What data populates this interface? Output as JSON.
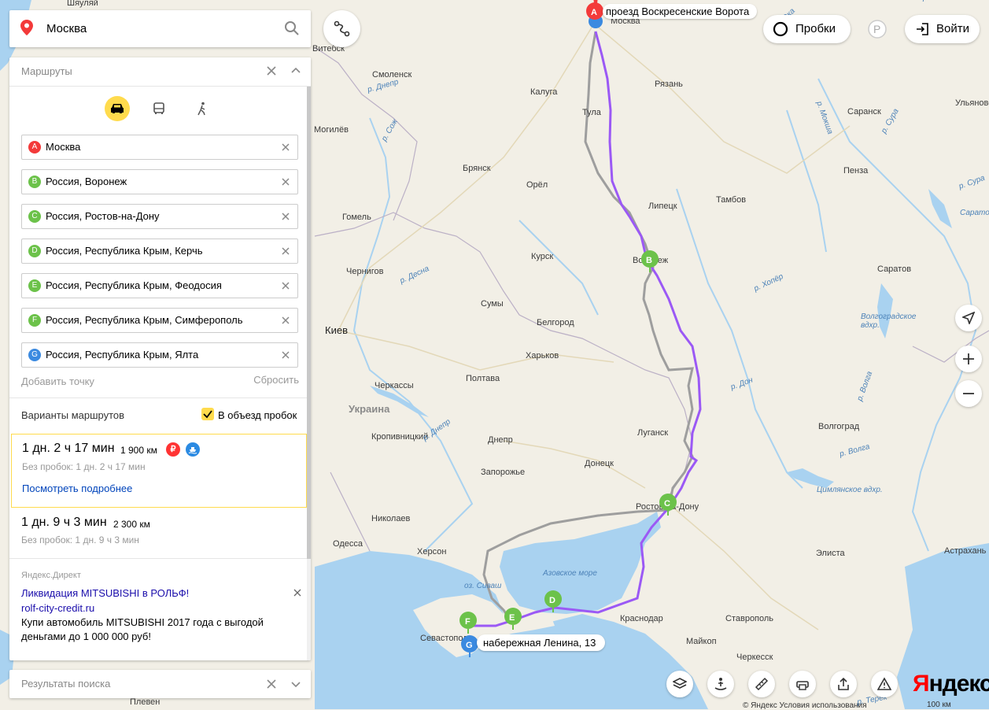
{
  "search": {
    "value": "Москва"
  },
  "panel": {
    "title": "Маршруты",
    "waypoints": [
      {
        "letter": "A",
        "text": "Москва",
        "color": "#f33a3a"
      },
      {
        "letter": "B",
        "text": "Россия, Воронеж",
        "color": "#6cc24a"
      },
      {
        "letter": "C",
        "text": "Россия, Ростов-на-Дону",
        "color": "#6cc24a"
      },
      {
        "letter": "D",
        "text": "Россия, Республика Крым, Керчь",
        "color": "#6cc24a"
      },
      {
        "letter": "E",
        "text": "Россия, Республика Крым, Феодосия",
        "color": "#6cc24a"
      },
      {
        "letter": "F",
        "text": "Россия, Республика Крым, Симферополь",
        "color": "#6cc24a"
      },
      {
        "letter": "G",
        "text": "Россия, Республика Крым, Ялта",
        "color": "#3b8ae0"
      }
    ],
    "add_point": "Добавить точку",
    "reset": "Сбросить",
    "variants_title": "Варианты маршрутов",
    "avoid_traffic": "В объезд пробок",
    "avoid_traffic_checked": true,
    "routes": [
      {
        "time": "1 дн. 2 ч 17 мин",
        "distance": "1 900 км",
        "sub": "Без пробок: 1 дн. 2 ч 17 мин",
        "details": "Посмотреть подробнее",
        "toll": "₽"
      },
      {
        "time": "1 дн. 9 ч 3 мин",
        "distance": "2 300 км",
        "sub": "Без пробок: 1 дн. 9 ч 3 мин"
      }
    ],
    "ad": {
      "label": "Яндекс.Директ",
      "title": "Ликвидация MITSUBISHI в РОЛЬФ!",
      "url": "rolf-city-credit.ru",
      "text": "Купи автомобиль MITSUBISHI 2017 года с выгодой деньгами до 1 000 000 руб!"
    }
  },
  "results": {
    "title": "Результаты поиска"
  },
  "controls": {
    "traffic": "Пробки",
    "parking": "P",
    "login": "Войти"
  },
  "map": {
    "start_label": "проезд Воскресенские Ворота",
    "start_letter": "A",
    "start_city_partial": "М",
    "end_label": "набережная Ленина, 13",
    "pins": [
      "B",
      "C",
      "D",
      "E",
      "F",
      "G"
    ],
    "route_color": "#9b59f5",
    "alt_route_color": "#a0a0a0",
    "cities": [
      "Москва",
      "Витебск",
      "Смоленск",
      "Калуга",
      "Рязань",
      "Тула",
      "Саранск",
      "Ульяновск",
      "Могилёв",
      "Брянск",
      "Орёл",
      "Липецк",
      "Тамбов",
      "Пенза",
      "Гомель",
      "Курск",
      "Воронеж",
      "Чернигов",
      "Саратов",
      "Киев",
      "Сумы",
      "Белгород",
      "Харьков",
      "Черкассы",
      "Полтава",
      "Луганск",
      "Волгоград",
      "Кропивницкий",
      "Днепр",
      "Донецк",
      "Запорожье",
      "Ростов-на-Дону",
      "Николаев",
      "Одесса",
      "Херсон",
      "Элиста",
      "Астрахань",
      "Севастополь",
      "Краснодар",
      "Ставрополь",
      "Майкоп",
      "Черкесск",
      "Плевен",
      "Шяуляй"
    ],
    "rivers": [
      "р. Днепр",
      "р. Сож",
      "р. Десна",
      "р. Днепр",
      "р. Ока",
      "р. Мокша",
      "р. Сура",
      "р. Сура",
      "р. Хопёр",
      "р. Дон",
      "р. Волга",
      "р. Дон",
      "р. Волга",
      "р. Терек"
    ],
    "country": "Украина",
    "waters": [
      "Азовское море",
      "оз. Сиваш",
      "Цимлянское вдхр.",
      "Волгоградское вдхр.",
      "Саратовское вдхр."
    ]
  },
  "footer": {
    "logo_first": "Я",
    "logo_rest": "ндекс",
    "copyright": "© Яндекс Условия использования",
    "scale": "100 км"
  }
}
